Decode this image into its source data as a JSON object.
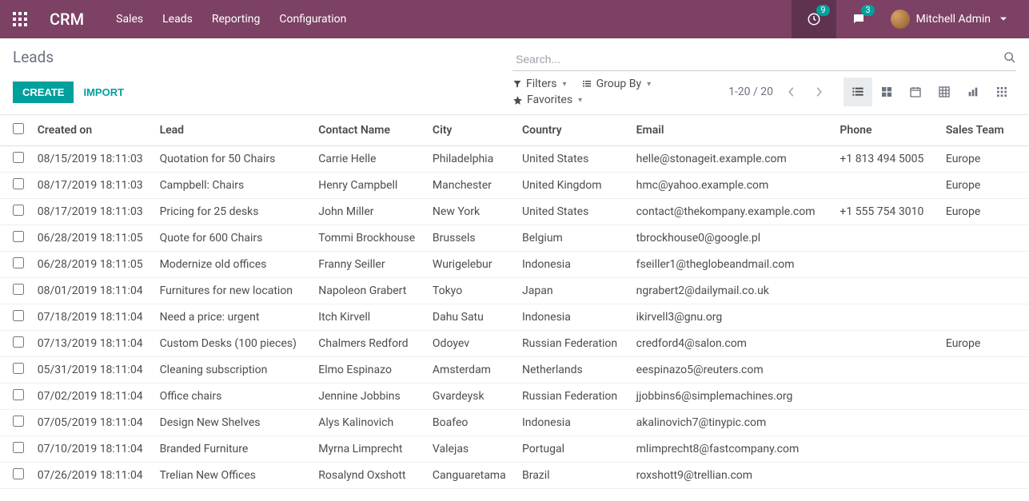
{
  "brand": "CRM",
  "nav": {
    "items": [
      "Sales",
      "Leads",
      "Reporting",
      "Configuration"
    ]
  },
  "header": {
    "clock_badge": "9",
    "chat_badge": "3",
    "user_name": "Mitchell Admin"
  },
  "breadcrumb": "Leads",
  "search": {
    "placeholder": "Search..."
  },
  "buttons": {
    "create": "CREATE",
    "import": "IMPORT"
  },
  "filters": {
    "filters": "Filters",
    "groupby": "Group By",
    "favorites": "Favorites"
  },
  "pager": {
    "range": "1-20 / 20"
  },
  "table": {
    "headers": {
      "created": "Created on",
      "lead": "Lead",
      "contact": "Contact Name",
      "city": "City",
      "country": "Country",
      "email": "Email",
      "phone": "Phone",
      "team": "Sales Team"
    },
    "rows": [
      {
        "created": "08/15/2019 18:11:03",
        "lead": "Quotation for 50 Chairs",
        "contact": "Carrie Helle",
        "city": "Philadelphia",
        "country": "United States",
        "email": "helle@stonageit.example.com",
        "phone": "+1 813 494 5005",
        "team": "Europe"
      },
      {
        "created": "08/17/2019 18:11:03",
        "lead": "Campbell: Chairs",
        "contact": "Henry Campbell",
        "city": "Manchester",
        "country": "United Kingdom",
        "email": "hmc@yahoo.example.com",
        "phone": "",
        "team": "Europe"
      },
      {
        "created": "08/17/2019 18:11:03",
        "lead": "Pricing for 25 desks",
        "contact": "John Miller",
        "city": "New York",
        "country": "United States",
        "email": "contact@thekompany.example.com",
        "phone": "+1 555 754 3010",
        "team": "Europe"
      },
      {
        "created": "06/28/2019 18:11:05",
        "lead": "Quote for 600 Chairs",
        "contact": "Tommi Brockhouse",
        "city": "Brussels",
        "country": "Belgium",
        "email": "tbrockhouse0@google.pl",
        "phone": "",
        "team": ""
      },
      {
        "created": "06/28/2019 18:11:05",
        "lead": "Modernize old offices",
        "contact": "Franny Seiller",
        "city": "Wurigelebur",
        "country": "Indonesia",
        "email": "fseiller1@theglobeandmail.com",
        "phone": "",
        "team": ""
      },
      {
        "created": "08/01/2019 18:11:04",
        "lead": "Furnitures for new location",
        "contact": "Napoleon Grabert",
        "city": "Tokyo",
        "country": "Japan",
        "email": "ngrabert2@dailymail.co.uk",
        "phone": "",
        "team": ""
      },
      {
        "created": "07/18/2019 18:11:04",
        "lead": "Need a price: urgent",
        "contact": "Itch Kirvell",
        "city": "Dahu Satu",
        "country": "Indonesia",
        "email": "ikirvell3@gnu.org",
        "phone": "",
        "team": ""
      },
      {
        "created": "07/13/2019 18:11:04",
        "lead": "Custom Desks (100 pieces)",
        "contact": "Chalmers Redford",
        "city": "Odoyev",
        "country": "Russian Federation",
        "email": "credford4@salon.com",
        "phone": "",
        "team": "Europe"
      },
      {
        "created": "05/31/2019 18:11:04",
        "lead": "Cleaning subscription",
        "contact": "Elmo Espinazo",
        "city": "Amsterdam",
        "country": "Netherlands",
        "email": "eespinazo5@reuters.com",
        "phone": "",
        "team": ""
      },
      {
        "created": "07/02/2019 18:11:04",
        "lead": "Office chairs",
        "contact": "Jennine Jobbins",
        "city": "Gvardeysk",
        "country": "Russian Federation",
        "email": "jjobbins6@simplemachines.org",
        "phone": "",
        "team": ""
      },
      {
        "created": "07/05/2019 18:11:04",
        "lead": "Design New Shelves",
        "contact": "Alys Kalinovich",
        "city": "Boafeo",
        "country": "Indonesia",
        "email": "akalinovich7@tinypic.com",
        "phone": "",
        "team": ""
      },
      {
        "created": "07/10/2019 18:11:04",
        "lead": "Branded Furniture",
        "contact": "Myrna Limprecht",
        "city": "Valejas",
        "country": "Portugal",
        "email": "mlimprecht8@fastcompany.com",
        "phone": "",
        "team": ""
      },
      {
        "created": "07/26/2019 18:11:04",
        "lead": "Trelian New Offices",
        "contact": "Rosalynd Oxshott",
        "city": "Canguaretama",
        "country": "Brazil",
        "email": "roxshott9@trellian.com",
        "phone": "",
        "team": ""
      }
    ]
  }
}
